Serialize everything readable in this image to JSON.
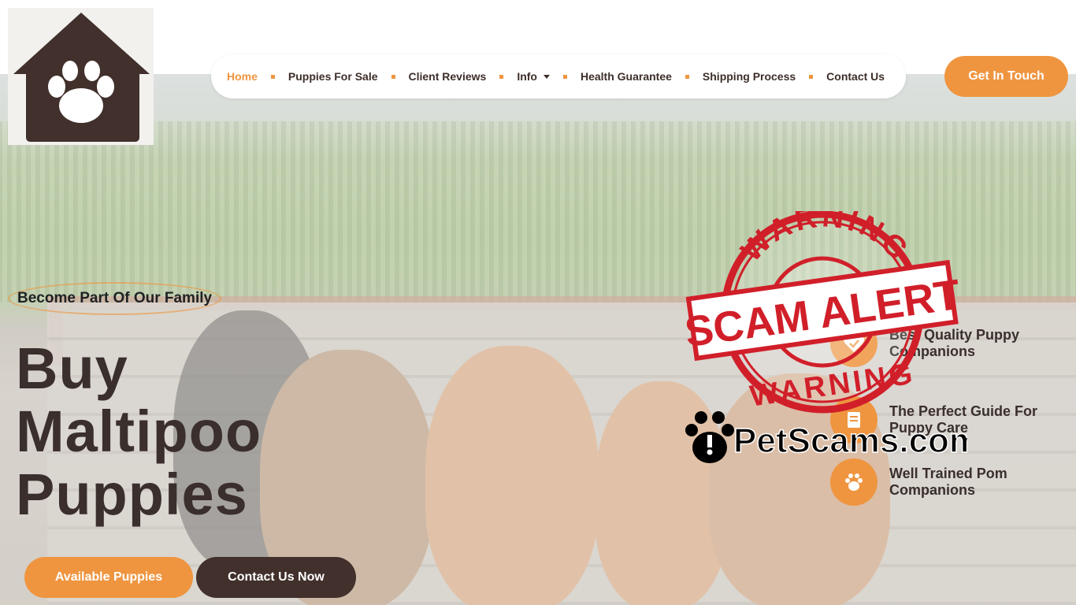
{
  "brand": {
    "logo_icon": "paw-house-icon"
  },
  "nav": {
    "items": [
      {
        "label": "Home",
        "active": true
      },
      {
        "label": "Puppies For Sale"
      },
      {
        "label": "Client Reviews"
      },
      {
        "label": "Info",
        "has_dropdown": true
      },
      {
        "label": "Health Guarantee"
      },
      {
        "label": "Shipping Process"
      },
      {
        "label": "Contact Us"
      }
    ],
    "cta_label": "Get In Touch"
  },
  "hero": {
    "tagline": "Become Part Of Our Family",
    "headline_lines": [
      "Buy",
      "Maltipoo",
      "Puppies"
    ],
    "primary_button": "Available Puppies",
    "secondary_button": "Contact Us Now",
    "features": [
      {
        "icon": "heart-check-icon",
        "text": "Best Quality Puppy Companions"
      },
      {
        "icon": "book-icon",
        "text": "The Perfect Guide For Puppy Care"
      },
      {
        "icon": "paw-icon",
        "text": "Well Trained Pom Companions"
      }
    ]
  },
  "overlay": {
    "warning_top": "WARNING",
    "scam_alert": "SCAM ALERT",
    "warning_bottom": "WARNING",
    "site": "PetScams.com"
  },
  "colors": {
    "accent": "#ef9540",
    "dark": "#41302b",
    "stamp_red": "#d11f2a"
  }
}
